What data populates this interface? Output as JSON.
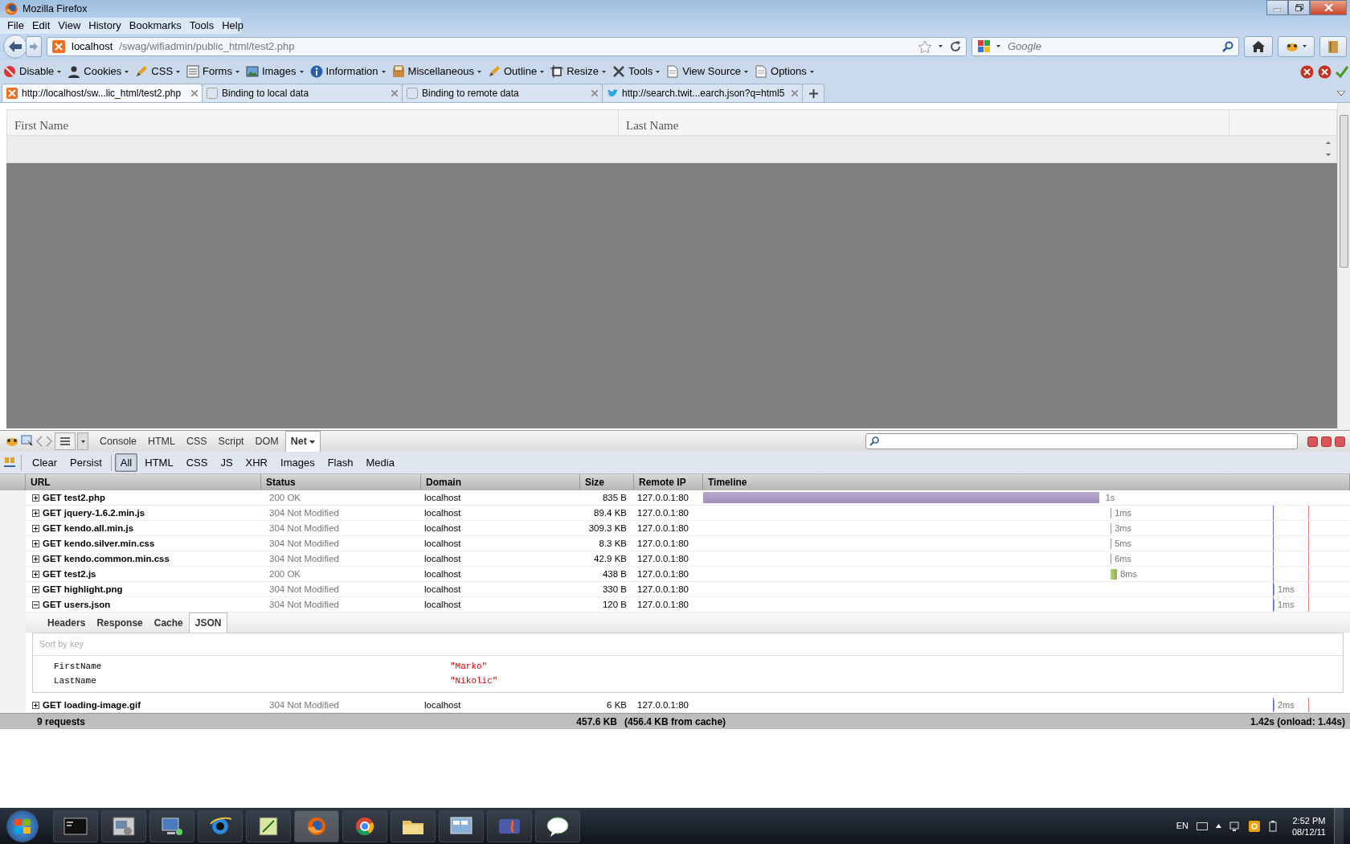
{
  "window": {
    "title": "Mozilla Firefox"
  },
  "menu": [
    "File",
    "Edit",
    "View",
    "History",
    "Bookmarks",
    "Tools",
    "Help"
  ],
  "address": {
    "host": "localhost",
    "path": "/swag/wifiadmin/public_html/test2.php"
  },
  "search": {
    "placeholder": "Google"
  },
  "webdev_toolbar": [
    {
      "label": "Disable",
      "kind": "disable"
    },
    {
      "label": "Cookies",
      "kind": "person"
    },
    {
      "label": "CSS",
      "kind": "pen"
    },
    {
      "label": "Forms",
      "kind": "form"
    },
    {
      "label": "Images",
      "kind": "image"
    },
    {
      "label": "Information",
      "kind": "info"
    },
    {
      "label": "Miscellaneous",
      "kind": "box"
    },
    {
      "label": "Outline",
      "kind": "pen"
    },
    {
      "label": "Resize",
      "kind": "resize"
    },
    {
      "label": "Tools",
      "kind": "tools"
    },
    {
      "label": "View Source",
      "kind": "page"
    },
    {
      "label": "Options",
      "kind": "page"
    }
  ],
  "tabs": [
    {
      "label": "http://localhost/sw...lic_html/test2.php",
      "selected": true,
      "kind": "site"
    },
    {
      "label": "Binding to local data",
      "selected": false,
      "kind": "blank"
    },
    {
      "label": "Binding to remote data",
      "selected": false,
      "kind": "blank"
    },
    {
      "label": "http://search.twit...earch.json?q=html5",
      "selected": false,
      "kind": "bird"
    }
  ],
  "grid": {
    "columns": [
      "First Name",
      "Last Name"
    ]
  },
  "firebug": {
    "panels": [
      {
        "label": "Console",
        "selected": false
      },
      {
        "label": "HTML",
        "selected": false
      },
      {
        "label": "CSS",
        "selected": false
      },
      {
        "label": "Script",
        "selected": false
      },
      {
        "label": "DOM",
        "selected": false
      },
      {
        "label": "Net",
        "selected": true
      }
    ],
    "buttons": [
      "Clear",
      "Persist"
    ],
    "filters": [
      {
        "label": "All",
        "selected": true
      },
      {
        "label": "HTML",
        "selected": false
      },
      {
        "label": "CSS",
        "selected": false
      },
      {
        "label": "JS",
        "selected": false
      },
      {
        "label": "XHR",
        "selected": false
      },
      {
        "label": "Images",
        "selected": false
      },
      {
        "label": "Flash",
        "selected": false
      },
      {
        "label": "Media",
        "selected": false
      }
    ],
    "columns": [
      "URL",
      "Status",
      "Domain",
      "Size",
      "Remote IP",
      "Timeline"
    ],
    "requests": [
      {
        "url": "GET test2.php",
        "status": "200 OK",
        "domain": "localhost",
        "size": "835 B",
        "ip": "127.0.0.1:80",
        "expanded": false,
        "timing": {
          "kind": "bar",
          "label": "1s"
        }
      },
      {
        "url": "GET jquery-1.6.2.min.js",
        "status": "304 Not Modified",
        "domain": "localhost",
        "size": "89.4 KB",
        "ip": "127.0.0.1:80",
        "expanded": false,
        "timing": {
          "kind": "tick",
          "label": "1ms"
        }
      },
      {
        "url": "GET kendo.all.min.js",
        "status": "304 Not Modified",
        "domain": "localhost",
        "size": "309.3 KB",
        "ip": "127.0.0.1:80",
        "expanded": false,
        "timing": {
          "kind": "tick",
          "label": "3ms"
        }
      },
      {
        "url": "GET kendo.silver.min.css",
        "status": "304 Not Modified",
        "domain": "localhost",
        "size": "8.3 KB",
        "ip": "127.0.0.1:80",
        "expanded": false,
        "timing": {
          "kind": "tick",
          "label": "5ms"
        }
      },
      {
        "url": "GET kendo.common.min.css",
        "status": "304 Not Modified",
        "domain": "localhost",
        "size": "42.9 KB",
        "ip": "127.0.0.1:80",
        "expanded": false,
        "timing": {
          "kind": "tick",
          "label": "6ms"
        }
      },
      {
        "url": "GET test2.js",
        "status": "200 OK",
        "domain": "localhost",
        "size": "438 B",
        "ip": "127.0.0.1:80",
        "expanded": false,
        "timing": {
          "kind": "block",
          "label": "8ms"
        }
      },
      {
        "url": "GET highlight.png",
        "status": "304 Not Modified",
        "domain": "localhost",
        "size": "330 B",
        "ip": "127.0.0.1:80",
        "expanded": false,
        "timing": {
          "kind": "late",
          "label": "1ms"
        }
      },
      {
        "url": "GET users.json",
        "status": "304 Not Modified",
        "domain": "localhost",
        "size": "120 B",
        "ip": "127.0.0.1:80",
        "expanded": true,
        "timing": {
          "kind": "late",
          "label": "1ms"
        }
      },
      {
        "url": "GET loading-image.gif",
        "status": "304 Not Modified",
        "domain": "localhost",
        "size": "6 KB",
        "ip": "127.0.0.1:80",
        "expanded": false,
        "timing": {
          "kind": "late",
          "label": "2ms"
        }
      }
    ],
    "detail_tabs": [
      {
        "label": "Headers",
        "selected": false
      },
      {
        "label": "Response",
        "selected": false
      },
      {
        "label": "Cache",
        "selected": false
      },
      {
        "label": "JSON",
        "selected": true
      }
    ],
    "sort_hint": "Sort by key",
    "json": [
      {
        "key": "FirstName",
        "value": "\"Marko\""
      },
      {
        "key": "LastName",
        "value": "\"Nikolic\""
      }
    ],
    "summary": {
      "count": "9 requests",
      "size": "457.6 KB",
      "cache": "(456.4 KB from cache)",
      "time": "1.42s (onload: 1.44s)"
    }
  },
  "taskbar": {
    "language": "EN",
    "time": "2:52 PM",
    "date": "08/12/11"
  }
}
